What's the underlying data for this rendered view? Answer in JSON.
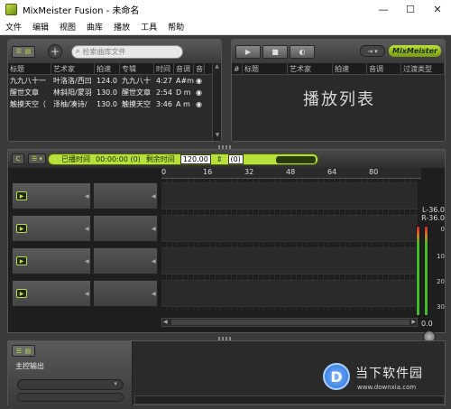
{
  "window": {
    "title": "MixMeister Fusion - 未命名",
    "minimize": "—",
    "maximize": "☐",
    "close": "✕"
  },
  "menu": [
    "文件",
    "编辑",
    "视图",
    "曲库",
    "播放",
    "工具",
    "帮助"
  ],
  "library": {
    "view_toggle": [
      "☰",
      "▤"
    ],
    "add_label": "+",
    "search_placeholder": "检索曲库文件",
    "columns": [
      "标题",
      "艺术家",
      "拍速",
      "专辑",
      "时间",
      "音调",
      "音存"
    ],
    "rows": [
      {
        "title": "九九八十一",
        "artist": "叶洛洛/西凹",
        "bpm": "124.0",
        "album": "九九八十",
        "time": "4:27",
        "key": "A#m",
        "cue": "◉"
      },
      {
        "title": "醒世文章",
        "artist": "林斜阳/蒙羽",
        "bpm": "130.0",
        "album": "醒世文章",
        "time": "2:54",
        "key": "D m",
        "cue": "◉"
      },
      {
        "title": "触摸天空（",
        "artist": "泽柚/凑诗/",
        "bpm": "130.0",
        "album": "触摸天空",
        "time": "3:46",
        "key": "A m",
        "cue": "◉"
      }
    ]
  },
  "playlist": {
    "transport": [
      "▶",
      "■",
      "◐"
    ],
    "mini_label": "⇥ ▾",
    "logo_text": "MixMeister",
    "columns": [
      "#",
      "标题",
      "艺术家",
      "拍速",
      "音调",
      "过渡类型"
    ],
    "placeholder": "播放列表"
  },
  "mixer": {
    "tool_buttons": [
      "C",
      "☰ ▾"
    ],
    "elapsed_label": "已播时间",
    "elapsed_value": "00:00:00 (0)",
    "remaining_label": "剩余时间",
    "bpm_value": "120.00",
    "bpm_stepper": "⇕",
    "remaining_value": "(0)",
    "ruler": [
      "0",
      "16",
      "32",
      "48",
      "64",
      "80"
    ],
    "track_count": 4,
    "meter": {
      "left_label": "L-36.0",
      "right_label": "R-36.0",
      "scale": [
        "0",
        "10",
        "20",
        "30"
      ],
      "value": "0.0"
    }
  },
  "output": {
    "title": "主控输出",
    "select_arrow": "▾"
  },
  "watermark": {
    "logo_glyph": "D",
    "name": "当下软件园",
    "url": "www.downxia.com"
  }
}
